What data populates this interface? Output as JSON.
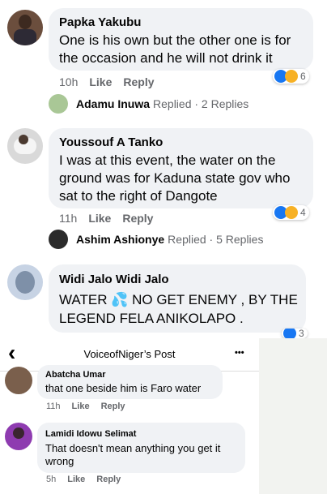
{
  "comments": [
    {
      "name": "Papka Yakubu",
      "text": "One is his own but the other one is for the occasion and he will not drink it",
      "time": "10h",
      "like": "Like",
      "reply": "Reply",
      "reactions": "6"
    },
    {
      "name": "Youssouf A Tanko",
      "text": "I was at this event, the water on the ground was for Kaduna state gov who sat to the right of Dangote",
      "time": "11h",
      "like": "Like",
      "reply": "Reply",
      "reactions": "4"
    },
    {
      "name": "Widi Jalo Widi Jalo",
      "text": "WATER 💦 NO GET ENEMY , BY THE LEGEND FELA ANIKOLAPO .",
      "reactions": "3"
    }
  ],
  "replies": [
    {
      "name": "Adamu Inuwa",
      "suffix": "Replied · 2 Replies"
    },
    {
      "name": "Ashim Ashionye",
      "suffix": "Replied · 5 Replies"
    }
  ],
  "post_header": {
    "title": "VoiceofNiger’s Post",
    "back": "‹",
    "more": "•••"
  },
  "post_comments": [
    {
      "name": "Abatcha Umar",
      "text": "that one beside him is Faro water",
      "time": "11h",
      "like": "Like",
      "reply": "Reply"
    },
    {
      "name": "Lamidi Idowu Selimat",
      "text": "That doesn't mean anything you get it wrong",
      "time": "5h",
      "like": "Like",
      "reply": "Reply"
    }
  ]
}
